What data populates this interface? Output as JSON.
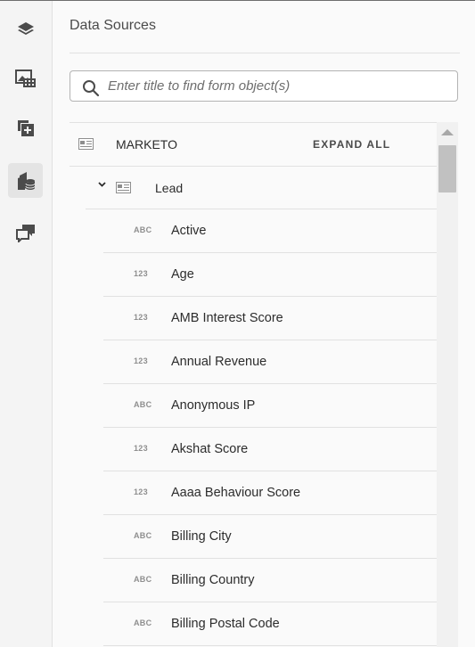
{
  "rail": {
    "items": [
      {
        "icon": "layers-icon",
        "active": false
      },
      {
        "icon": "image-media-icon",
        "active": false
      },
      {
        "icon": "add-fragment-icon",
        "active": false
      },
      {
        "icon": "data-sources-icon",
        "active": true
      },
      {
        "icon": "comments-icon",
        "active": false
      }
    ]
  },
  "panel": {
    "title": "Data Sources",
    "search_placeholder": "Enter title to find form object(s)"
  },
  "tree": {
    "root": {
      "label": "MARKETO",
      "expand_all": "EXPAND ALL",
      "icon": "form-object-icon"
    },
    "lead": {
      "label": "Lead",
      "icon": "form-object-icon",
      "expanded": true
    },
    "fields": [
      {
        "type": "ABC",
        "label": "Active"
      },
      {
        "type": "123",
        "label": "Age"
      },
      {
        "type": "123",
        "label": "AMB Interest Score"
      },
      {
        "type": "123",
        "label": "Annual Revenue"
      },
      {
        "type": "ABC",
        "label": "Anonymous IP"
      },
      {
        "type": "123",
        "label": "Akshat Score"
      },
      {
        "type": "123",
        "label": "Aaaa Behaviour Score"
      },
      {
        "type": "ABC",
        "label": "Billing City"
      },
      {
        "type": "ABC",
        "label": "Billing Country"
      },
      {
        "type": "ABC",
        "label": "Billing Postal Code"
      }
    ]
  },
  "colors": {
    "rail_bg": "#f4f4f4",
    "panel_bg": "#fafafa",
    "divider": "#e1e1e1",
    "icon": "#4b4b4b",
    "badge": "#8e8e8e"
  }
}
